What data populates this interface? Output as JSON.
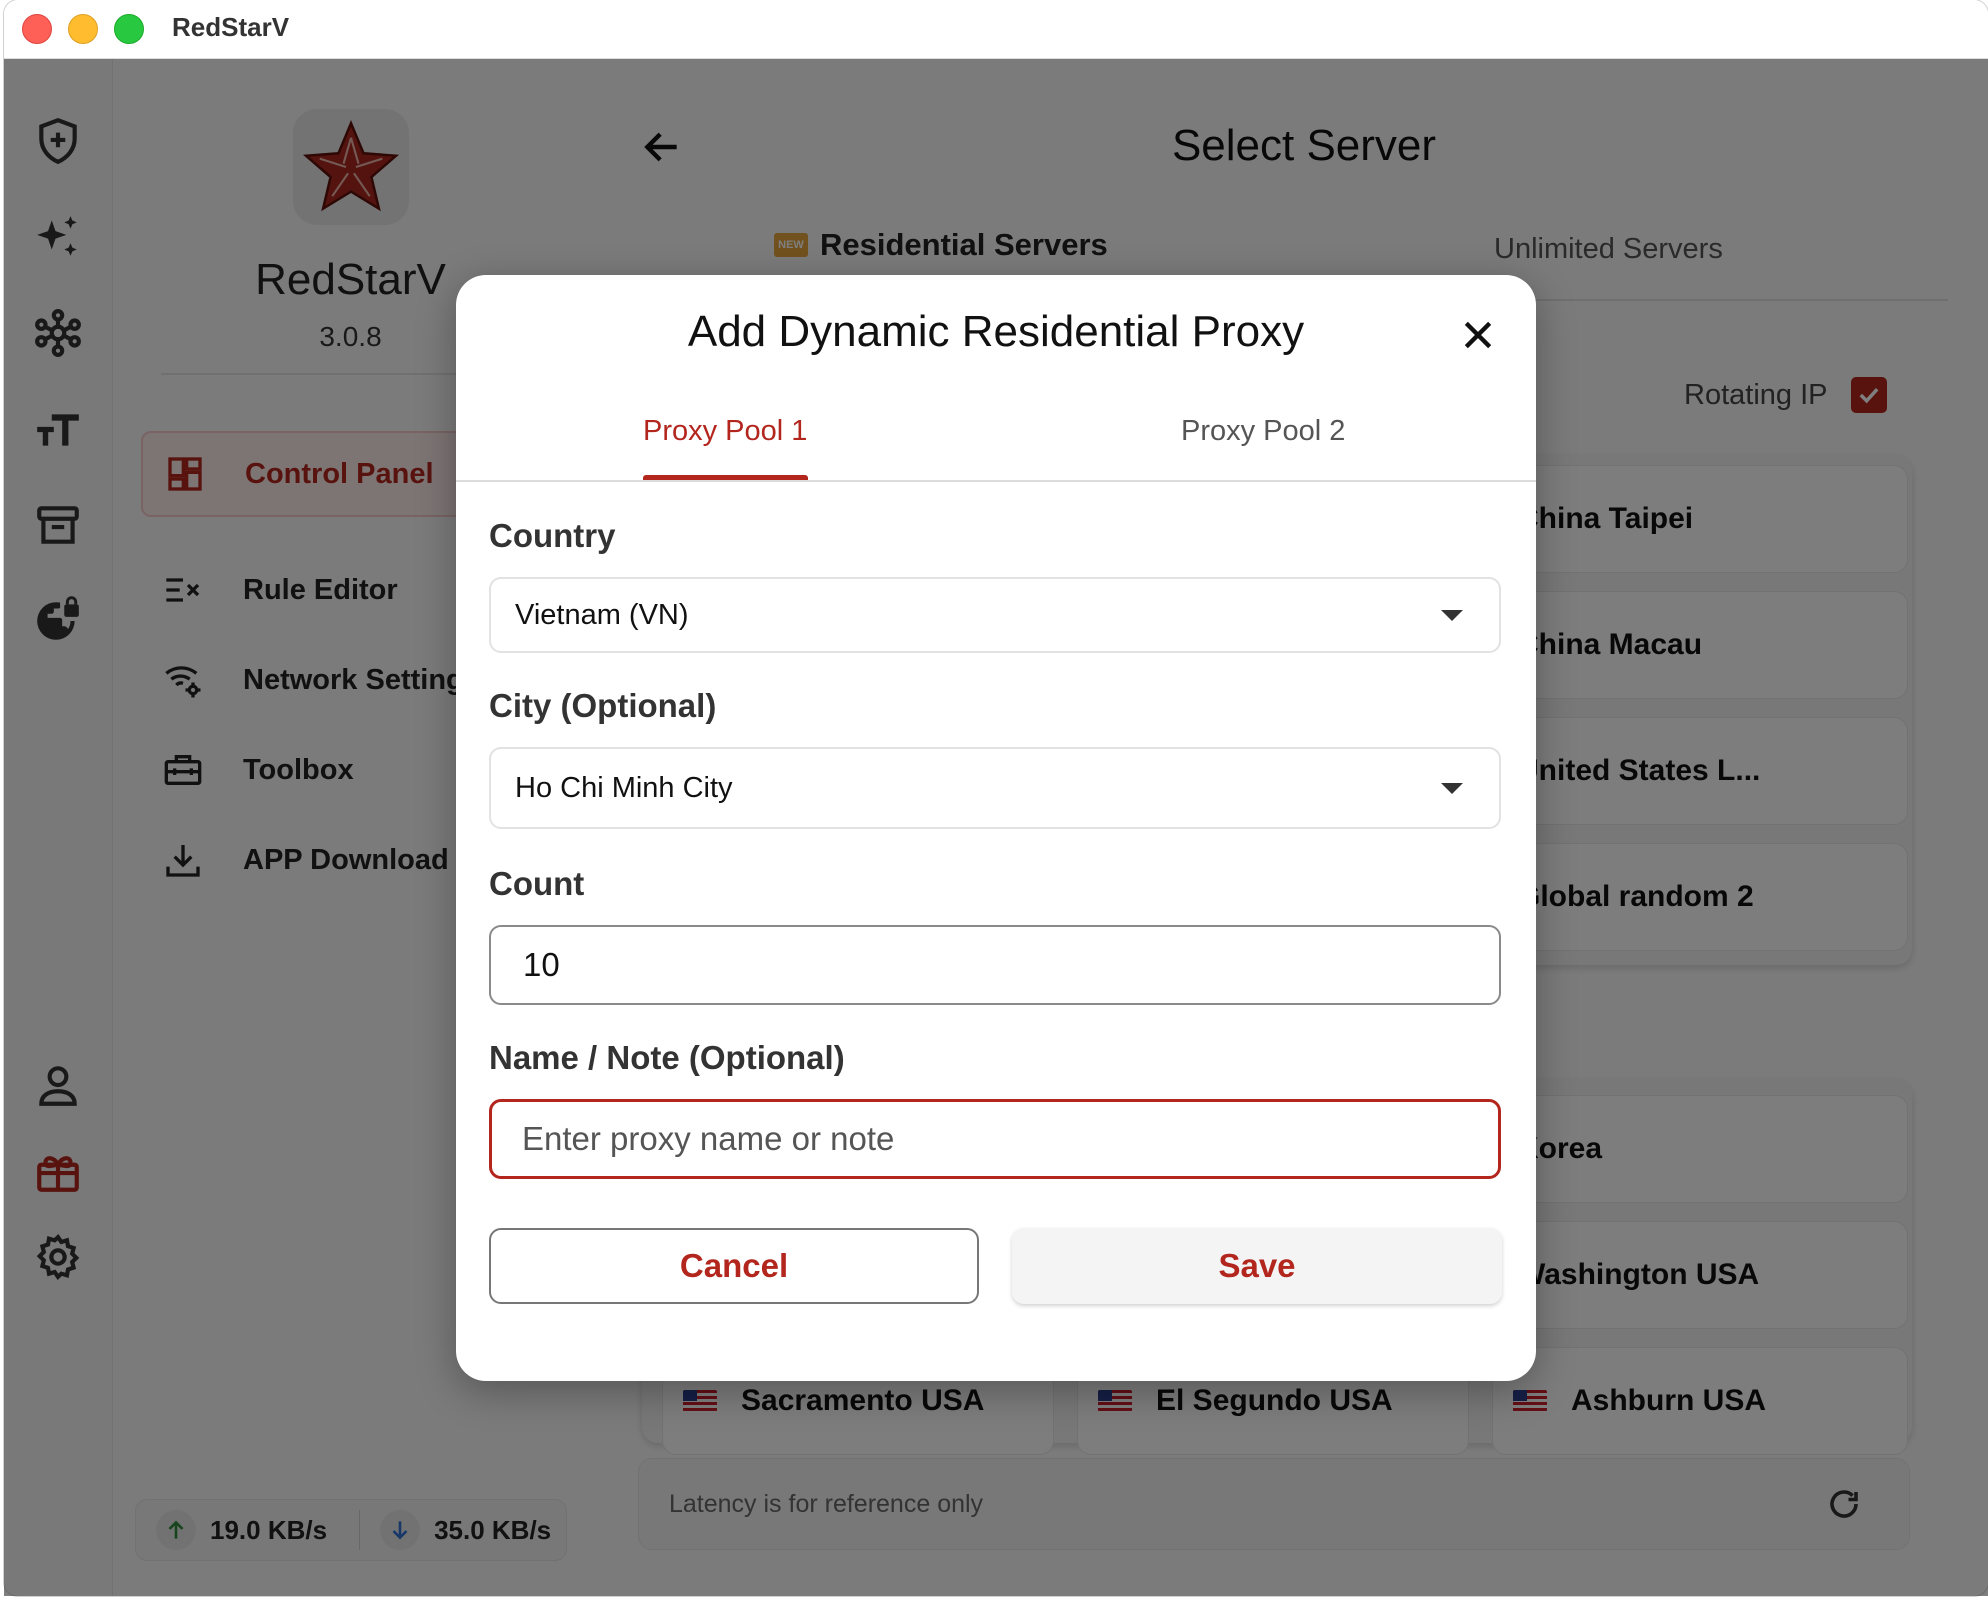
{
  "window": {
    "title": "RedStarV"
  },
  "app": {
    "name": "RedStarV",
    "version": "3.0.8"
  },
  "nav": {
    "items": [
      {
        "label": "Control Panel",
        "icon": "dashboard-icon",
        "active": true
      },
      {
        "label": "Rule Editor",
        "icon": "rule-list-icon",
        "active": false
      },
      {
        "label": "Network Settings",
        "icon": "wifi-gear-icon",
        "active": false
      },
      {
        "label": "Toolbox",
        "icon": "toolbox-icon",
        "active": false
      },
      {
        "label": "APP Download",
        "icon": "download-icon",
        "active": false
      }
    ]
  },
  "speed": {
    "upload": "19.0 KB/s",
    "download": "35.0 KB/s"
  },
  "main": {
    "title": "Select Server",
    "tabs": [
      {
        "label": "Residential Servers",
        "badge": "NEW",
        "active": true
      },
      {
        "label": "Unlimited Servers",
        "active": false
      }
    ],
    "rotating_label": "Rotating IP",
    "rotating_checked": true,
    "servers_top": [
      "China Taipei",
      "China Macau",
      "United States L...",
      "Global random 2"
    ],
    "servers_bottom": [
      "Korea",
      "Washington USA"
    ],
    "servers_bottom_row": [
      "Sacramento USA",
      "El Segundo USA",
      "Ashburn USA"
    ],
    "footer_note": "Latency is for reference only"
  },
  "dialog": {
    "title": "Add Dynamic Residential Proxy",
    "tabs": [
      {
        "label": "Proxy Pool 1",
        "active": true
      },
      {
        "label": "Proxy Pool 2",
        "active": false
      }
    ],
    "country_label": "Country",
    "country_value": "Vietnam (VN)",
    "city_label": "City (Optional)",
    "city_value": "Ho Chi Minh City",
    "count_label": "Count",
    "count_value": "10",
    "name_label": "Name / Note (Optional)",
    "name_placeholder": "Enter proxy name or note",
    "cancel_label": "Cancel",
    "save_label": "Save"
  },
  "colors": {
    "accent": "#b3261e",
    "scrim": "rgba(0,0,0,0.5)"
  }
}
